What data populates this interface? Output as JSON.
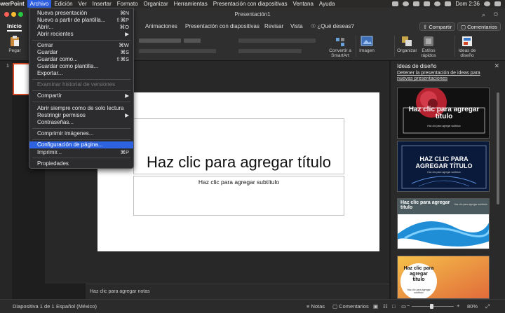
{
  "menubar": {
    "app": "owerPoint",
    "items": [
      "Archivo",
      "Edición",
      "Ver",
      "Insertar",
      "Formato",
      "Organizar",
      "Herramientas",
      "Presentación con diapositivas",
      "Ventana",
      "Ayuda"
    ],
    "clock": "Dom 2:36"
  },
  "window": {
    "title": "Presentación1"
  },
  "ribbon": {
    "tabs": {
      "home": "Inicio",
      "animations": "Animaciones",
      "slideshow": "Presentación con diapositivas",
      "review": "Revisar",
      "view": "Vista",
      "tell_me": "¿Qué deseas?"
    },
    "share": "Compartir",
    "comments": "Comentarios",
    "tools": {
      "paste": "Pegar",
      "smartart": "Convertir a SmartArt",
      "image": "Imagen",
      "arrange": "Organizar",
      "quick_styles": "Estilos rápidos",
      "design_ideas": "Ideas de diseño"
    }
  },
  "file_menu": {
    "new": {
      "label": "Nueva presentación",
      "shortcut": "⌘N"
    },
    "from_template": {
      "label": "Nuevo a partir de plantilla...",
      "shortcut": "⇧⌘P"
    },
    "open": {
      "label": "Abrir...",
      "shortcut": "⌘O"
    },
    "open_recent": {
      "label": "Abrir recientes"
    },
    "close": {
      "label": "Cerrar",
      "shortcut": "⌘W"
    },
    "save": {
      "label": "Guardar",
      "shortcut": "⌘S"
    },
    "save_as": {
      "label": "Guardar como...",
      "shortcut": "⇧⌘S"
    },
    "save_as_template": {
      "label": "Guardar como plantilla..."
    },
    "export": {
      "label": "Exportar..."
    },
    "version_history": {
      "label": "Examinar historial de versiones"
    },
    "share": {
      "label": "Compartir"
    },
    "open_readonly": {
      "label": "Abrir siempre como de solo lectura"
    },
    "restrict": {
      "label": "Restringir permisos"
    },
    "passwords": {
      "label": "Contraseñas..."
    },
    "compress": {
      "label": "Comprimir imágenes..."
    },
    "page_setup": {
      "label": "Configuración de página..."
    },
    "print": {
      "label": "Imprimir...",
      "shortcut": "⌘P"
    },
    "properties": {
      "label": "Propiedades"
    }
  },
  "thumbnails": {
    "slide_number": "1"
  },
  "slide": {
    "title_placeholder": "Haz clic para agregar título",
    "subtitle_placeholder": "Haz clic para agregar subtítulo"
  },
  "notes": {
    "placeholder": "Haz clic para agregar notas"
  },
  "design_pane": {
    "title": "Ideas de diseño",
    "link": "Detener la presentación de ideas para nuevas presentaciones",
    "ideas": [
      {
        "title": "Haz clic para agregar título",
        "subtitle": "Haz clic para agregar subtítulo"
      },
      {
        "title": "HAZ CLIC PARA AGREGAR TÍTULO",
        "subtitle": "Haz clic para agregar subtítulo"
      },
      {
        "title": "Haz clic para agregar título",
        "subtitle": "Haz clic para agregar subtítulo"
      },
      {
        "title": "Haz clic para agregar título",
        "subtitle": "Haz clic para agregar subtítulo"
      }
    ]
  },
  "statusbar": {
    "slide_info": "Diapositiva 1 de 1",
    "language": "Español (México)",
    "notes": "Notas",
    "comments": "Comentarios",
    "zoom": "80%"
  },
  "colors": {
    "accent_highlight": "#2d63e0",
    "powerpoint_orange": "#d24726"
  }
}
